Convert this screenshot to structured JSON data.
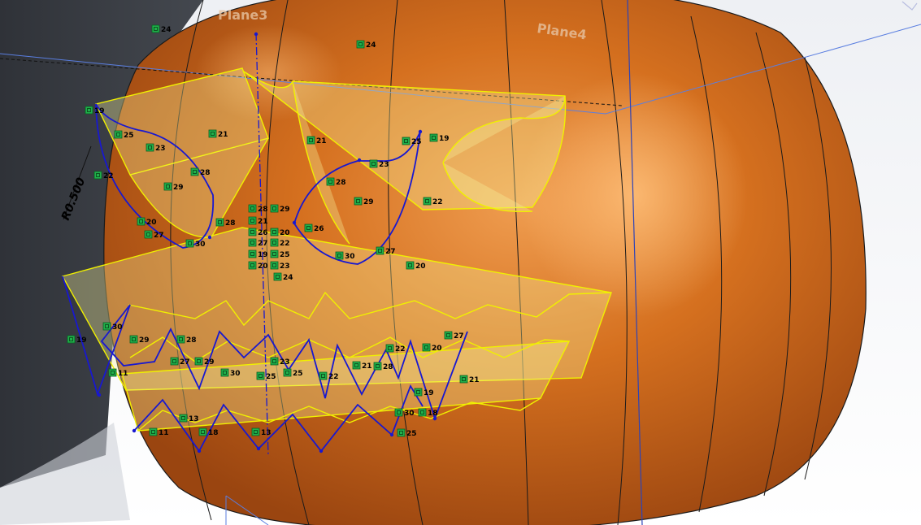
{
  "viewport": {
    "name": "SolidWorks graphics area - pumpkin model"
  },
  "planes": [
    {
      "id": "plane3",
      "label": "Plane3"
    },
    {
      "id": "plane4",
      "label": "Plane4"
    }
  ],
  "dimension": {
    "label": "R0.500"
  },
  "colors": {
    "pumpkin": "#d0671b",
    "pumpkin_highlight": "#ee9a4c",
    "pumpkin_shadow": "#8c3a0a",
    "sketch": "#1818d0",
    "feature_edge": "#f0f000",
    "relation_icon": "#1fb04a",
    "background_dark": "#373b42",
    "plane_line": "#5a7ee0"
  },
  "relations": [
    {
      "text": "24"
    },
    {
      "text": "24"
    },
    {
      "text": "19"
    },
    {
      "text": "25"
    },
    {
      "text": "21"
    },
    {
      "text": "23"
    },
    {
      "text": "22"
    },
    {
      "text": "28"
    },
    {
      "text": "29"
    },
    {
      "text": "20"
    },
    {
      "text": "27"
    },
    {
      "text": "30"
    },
    {
      "text": "28"
    },
    {
      "text": "21"
    },
    {
      "text": "25"
    },
    {
      "text": "19"
    },
    {
      "text": "23"
    },
    {
      "text": "28"
    },
    {
      "text": "29"
    },
    {
      "text": "22"
    },
    {
      "text": "26"
    },
    {
      "text": "27"
    },
    {
      "text": "30"
    },
    {
      "text": "20"
    },
    {
      "text": "28"
    },
    {
      "text": "29"
    },
    {
      "text": "21"
    },
    {
      "text": "20"
    },
    {
      "text": "26"
    },
    {
      "text": "27"
    },
    {
      "text": "22"
    },
    {
      "text": "19"
    },
    {
      "text": "25"
    },
    {
      "text": "20"
    },
    {
      "text": "23"
    },
    {
      "text": "24"
    },
    {
      "text": "30"
    },
    {
      "text": "19"
    },
    {
      "text": "29"
    },
    {
      "text": "28"
    },
    {
      "text": "27"
    },
    {
      "text": "29"
    },
    {
      "text": "11"
    },
    {
      "text": "30"
    },
    {
      "text": "23"
    },
    {
      "text": "25"
    },
    {
      "text": "25"
    },
    {
      "text": "22"
    },
    {
      "text": "21"
    },
    {
      "text": "28"
    },
    {
      "text": "22"
    },
    {
      "text": "20"
    },
    {
      "text": "27"
    },
    {
      "text": "21"
    },
    {
      "text": "13"
    },
    {
      "text": "18"
    },
    {
      "text": "11"
    },
    {
      "text": "13"
    },
    {
      "text": "19"
    },
    {
      "text": "30"
    },
    {
      "text": "18"
    },
    {
      "text": "25"
    }
  ]
}
